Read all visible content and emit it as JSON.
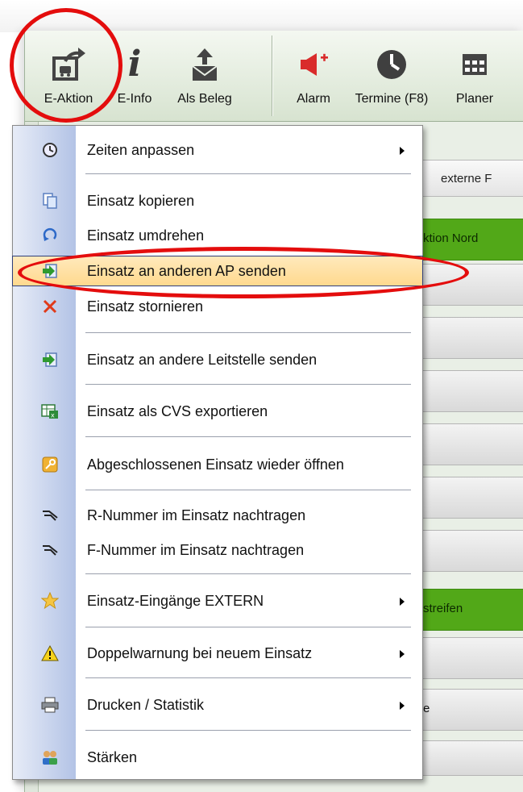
{
  "toolbar": {
    "buttons": [
      {
        "label": "E-Aktion",
        "icon": "vehicle-action-icon"
      },
      {
        "label": "E-Info",
        "icon": "info-icon"
      },
      {
        "label": "Als Beleg",
        "icon": "envelope-upload-icon"
      },
      {
        "label": "Alarm",
        "icon": "megaphone-icon"
      },
      {
        "label": "Termine (F8)",
        "icon": "clock-icon"
      },
      {
        "label": "Planer",
        "icon": "calendar-grid-icon"
      }
    ]
  },
  "background": {
    "tab_label": "externe F",
    "row_labels": [
      "ktion Nord",
      "streifen",
      "e"
    ]
  },
  "menu": {
    "items": [
      {
        "label": "Zeiten anpassen",
        "icon": "clock-icon",
        "submenu": true
      },
      {
        "label": "Einsatz kopieren",
        "icon": "copy-icon",
        "submenu": false
      },
      {
        "label": "Einsatz umdrehen",
        "icon": "rotate-icon",
        "submenu": false
      },
      {
        "label": "Einsatz an anderen AP senden",
        "icon": "send-icon",
        "submenu": false,
        "highlighted": true
      },
      {
        "label": "Einsatz stornieren",
        "icon": "cancel-x-icon",
        "submenu": false
      },
      {
        "label": "Einsatz an andere Leitstelle senden",
        "icon": "send-icon",
        "submenu": false
      },
      {
        "label": "Einsatz als CVS exportieren",
        "icon": "spreadsheet-export-icon",
        "submenu": false
      },
      {
        "label": "Abgeschlossenen Einsatz wieder öffnen",
        "icon": "key-icon",
        "submenu": false
      },
      {
        "label": "R-Nummer im Einsatz nachtragen",
        "icon": "pen-tag-icon",
        "submenu": false
      },
      {
        "label": "F-Nummer im Einsatz nachtragen",
        "icon": "pen-tag-icon",
        "submenu": false
      },
      {
        "label": "Einsatz-Eingänge EXTERN",
        "icon": "star-icon",
        "submenu": true
      },
      {
        "label": "Doppelwarnung bei neuem Einsatz",
        "icon": "warning-icon",
        "submenu": true
      },
      {
        "label": "Drucken / Statistik",
        "icon": "printer-icon",
        "submenu": true
      },
      {
        "label": "Stärken",
        "icon": "people-icon",
        "submenu": false
      }
    ]
  },
  "colors": {
    "annotation_ring": "#e40d0d",
    "highlight": "#ffd98e",
    "status_green": "#52a818"
  }
}
